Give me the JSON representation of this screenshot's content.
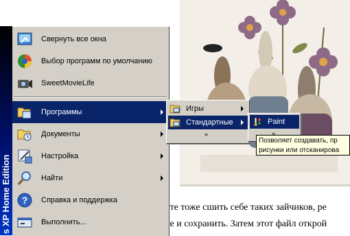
{
  "document": {
    "line1": "ите тоже сшить себе таких зайчиков, ре",
    "line2": "не и сохранить. Затем этот файл открой"
  },
  "sidebar": {
    "text": "s XP  Home Edition"
  },
  "start_menu": {
    "items": [
      {
        "label": "Свернуть все окна",
        "icon": "show-desktop-icon"
      },
      {
        "label": "Выбор программ по умолчанию",
        "icon": "default-programs-icon"
      },
      {
        "label": "SweetMovieLife",
        "icon": "camera-icon"
      },
      {
        "label": "Программы",
        "icon": "programs-folder-icon",
        "selected": true,
        "submenu": true
      },
      {
        "label": "Документы",
        "icon": "documents-icon",
        "submenu": true
      },
      {
        "label": "Настройка",
        "icon": "settings-icon",
        "submenu": true
      },
      {
        "label": "Найти",
        "icon": "search-icon",
        "submenu": true
      },
      {
        "label": "Справка и поддержка",
        "icon": "help-icon"
      },
      {
        "label": "Выполнить...",
        "icon": "run-icon"
      }
    ]
  },
  "programs_menu": {
    "items": [
      {
        "label": "Игры",
        "icon": "games-folder-icon"
      },
      {
        "label": "Стандартные",
        "icon": "accessories-folder-icon",
        "selected": true
      }
    ],
    "more": "»"
  },
  "accessories_menu": {
    "items": [
      {
        "label": "Paint",
        "icon": "paint-icon",
        "selected": true
      }
    ],
    "more": "»"
  },
  "tooltip": {
    "line1": "Позволяет создавать, пр",
    "line2": "рисунки или отсканирова"
  },
  "colors": {
    "selection": "#0a246a",
    "menu_bg": "#d4d0c8",
    "tooltip_bg": "#ffffe1"
  }
}
